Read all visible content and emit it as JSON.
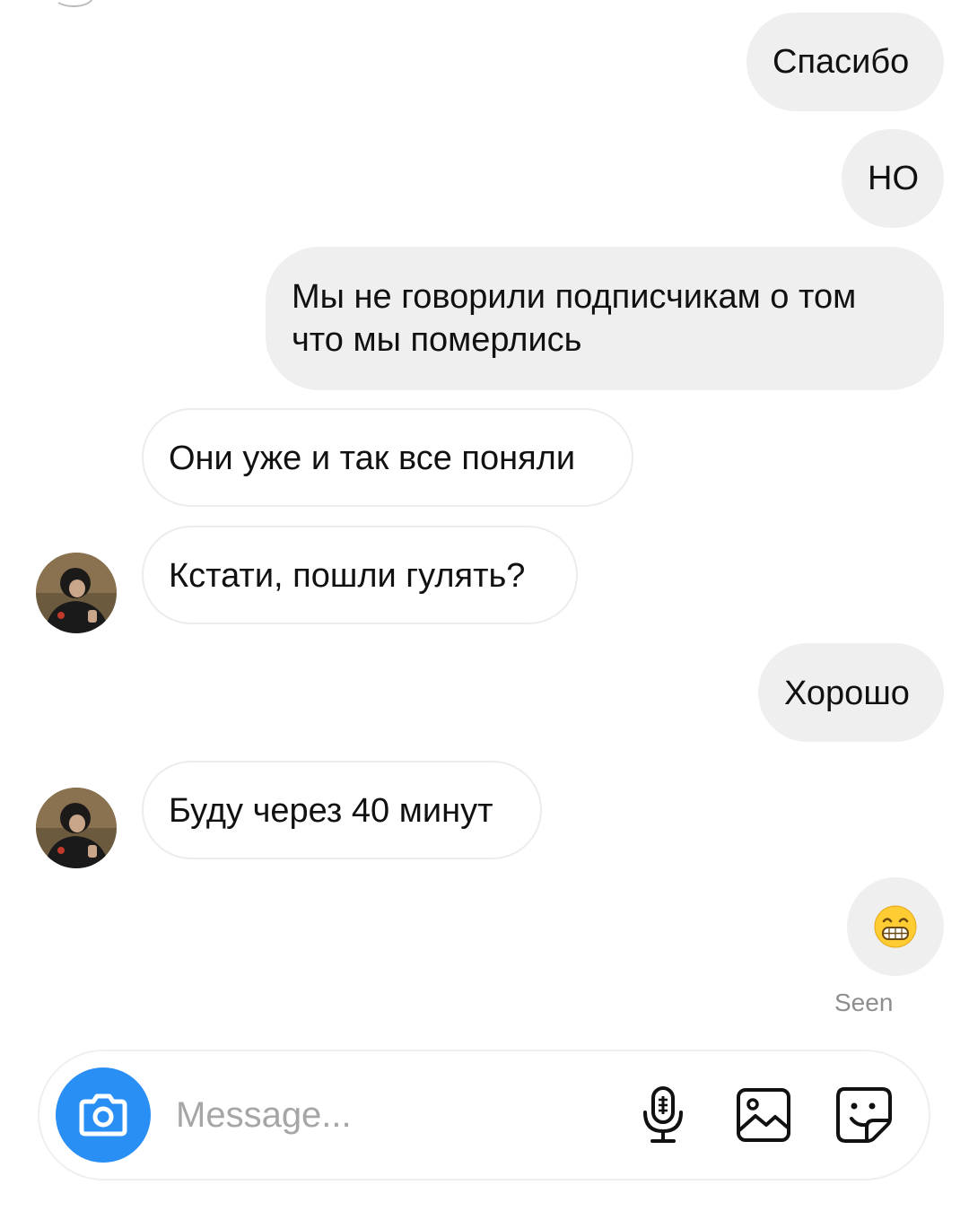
{
  "messages": [
    {
      "side": "sent",
      "text": "Спасибо"
    },
    {
      "side": "sent",
      "text": "НО"
    },
    {
      "side": "sent",
      "lines": [
        "Мы не говорили подписчикам о том",
        "что мы померлись"
      ]
    },
    {
      "side": "received",
      "text": "Они уже и так все поняли"
    },
    {
      "side": "received",
      "text": "Кстати, пошли гулять?"
    },
    {
      "side": "sent",
      "text": "Хорошо"
    },
    {
      "side": "received",
      "text": "Буду через 40 минут"
    },
    {
      "side": "sent",
      "emoji": "grinning-face-with-smiling-eyes"
    }
  ],
  "status": {
    "seen_label": "Seen"
  },
  "composer": {
    "placeholder": "Message...",
    "value": "",
    "icons": [
      "camera-icon",
      "microphone-icon",
      "gallery-icon",
      "sticker-icon"
    ]
  },
  "colors": {
    "sent_bubble": "#efefef",
    "received_border": "#ececec",
    "camera_button": "#2a8ff5",
    "placeholder": "#a6a6a6",
    "seen": "#8e8e8e"
  }
}
